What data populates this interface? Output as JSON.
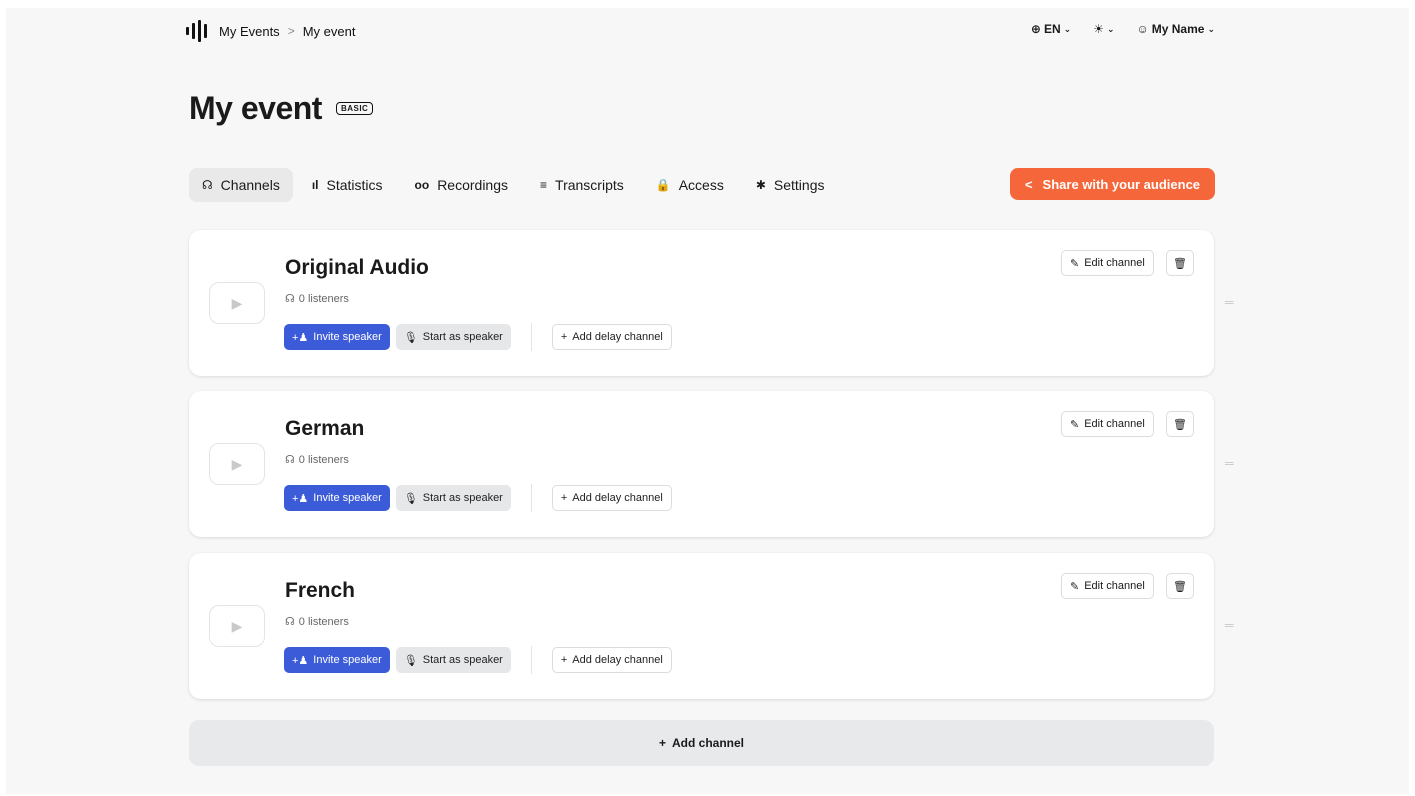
{
  "breadcrumb": {
    "root": "My Events",
    "separator": ">",
    "current": "My event"
  },
  "top_right": {
    "language": "EN",
    "theme_icon": "☀",
    "user": "My Name"
  },
  "page": {
    "title": "My event",
    "badge": "BASIC"
  },
  "tabs": [
    {
      "label": "Channels",
      "icon": "headphones-icon",
      "glyph": "☊"
    },
    {
      "label": "Statistics",
      "icon": "bar-chart-icon",
      "glyph": "ıl"
    },
    {
      "label": "Recordings",
      "icon": "voicemail-icon",
      "glyph": "oo"
    },
    {
      "label": "Transcripts",
      "icon": "lines-icon",
      "glyph": "≡"
    },
    {
      "label": "Access",
      "icon": "lock-icon",
      "glyph": "🔒"
    },
    {
      "label": "Settings",
      "icon": "gear-icon",
      "glyph": "✱"
    }
  ],
  "share_button": {
    "label": "Share with your audience",
    "color": "#f5673a"
  },
  "channels": [
    {
      "name": "Original Audio",
      "listeners": "0 listeners"
    },
    {
      "name": "German",
      "listeners": "0 listeners"
    },
    {
      "name": "French",
      "listeners": "0 listeners"
    }
  ],
  "channel_actions": {
    "invite": "Invite speaker",
    "start": "Start as speaker",
    "delay": "Add delay channel",
    "edit": "Edit channel"
  },
  "add_channel": {
    "label": "Add channel"
  },
  "colors": {
    "accent_blue": "#3c5bd9",
    "accent_orange": "#f5673a"
  }
}
